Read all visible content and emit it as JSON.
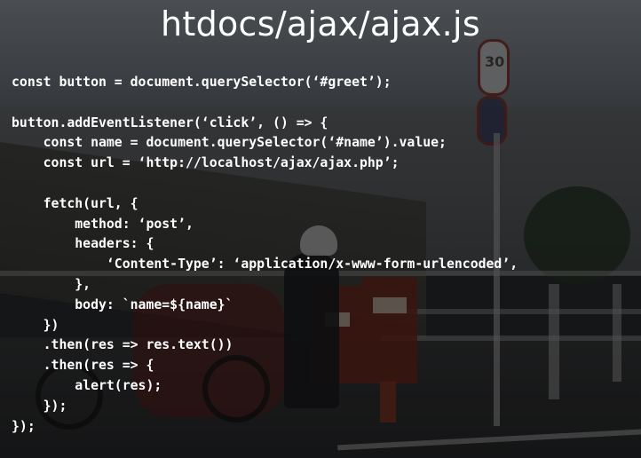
{
  "slide": {
    "title": "htdocs/ajax/ajax.js",
    "code_lines": [
      "const button = document.querySelector(‘#greet’);",
      "",
      "button.addEventListener(‘click’, () => {",
      "    const name = document.querySelector(‘#name’).value;",
      "    const url = ‘http://localhost/ajax/ajax.php’;",
      "",
      "    fetch(url, {",
      "        method: ‘post’,",
      "        headers: {",
      "            ‘Content-Type’: ‘application/x-www-form-urlencoded’,",
      "        },",
      "        body: `name=${name}`",
      "    })",
      "    .then(res => res.text())",
      "    .then(res => {",
      "        alert(res);",
      "    });",
      "});"
    ]
  },
  "background": {
    "speed_sign_number": "30"
  }
}
